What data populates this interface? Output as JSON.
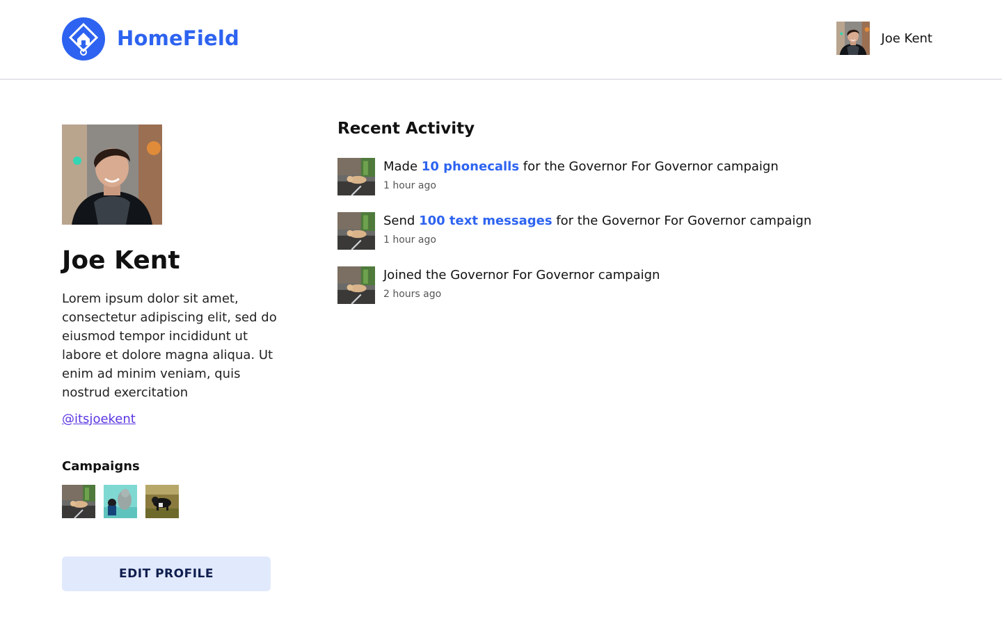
{
  "header": {
    "brand": "HomeField",
    "logo_icon": "home-diamond-icon",
    "brand_color": "#2d63f0",
    "user_name": "Joe Kent"
  },
  "profile": {
    "name": "Joe Kent",
    "bio": "Lorem ipsum dolor sit amet, consectetur adipiscing elit, sed do eiusmod tempor incididunt ut labore et dolore magna aliqua. Ut enim ad minim veniam, quis nostrud exercitation",
    "handle": "@itsjoekent",
    "campaigns_title": "Campaigns",
    "campaigns": [
      "campaign-dog-garden",
      "campaign-dog-aquarium",
      "campaign-dog-grass"
    ],
    "edit_button": "EDIT PROFILE"
  },
  "activity": {
    "title": "Recent Activity",
    "items": [
      {
        "prefix": "Made ",
        "highlight": "10 phonecalls",
        "suffix": " for the Governor For Governor campaign",
        "time": "1 hour ago"
      },
      {
        "prefix": "Send ",
        "highlight": "100 text messages",
        "suffix": " for the Governor For Governor campaign",
        "time": "1 hour ago"
      },
      {
        "prefix": "Joined the Governor For Governor campaign",
        "highlight": "",
        "suffix": "",
        "time": "2 hours ago"
      }
    ]
  },
  "colors": {
    "accent": "#2d63f0",
    "link": "#5b36e0",
    "button_bg": "#e1e9fc",
    "button_text": "#0f1d4e"
  }
}
